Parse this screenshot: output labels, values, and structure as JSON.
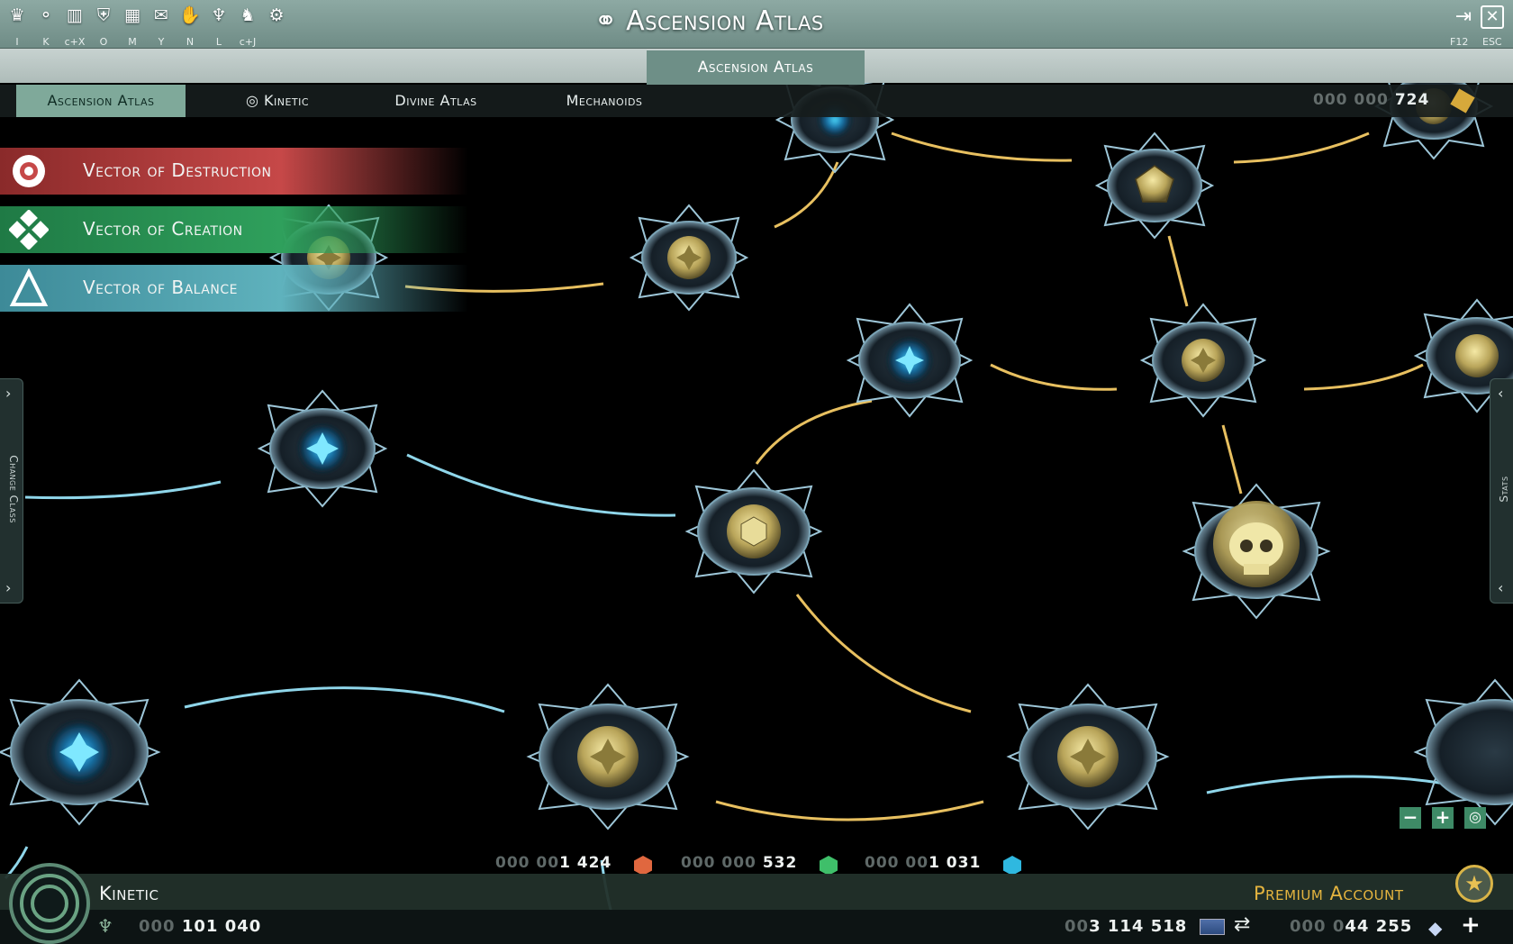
{
  "window": {
    "title": "Ascension Atlas",
    "top_icons": [
      "alert-icon",
      "network-icon",
      "stats-icon",
      "armor-icon",
      "map-icon",
      "chat-icon",
      "handshake-icon",
      "clan-icon",
      "mount-icon",
      "settings-icon"
    ],
    "hotkeys": [
      "I",
      "K",
      "c+X",
      "O",
      "M",
      "Y",
      "N",
      "L",
      "c+J"
    ],
    "right_hotkeys": [
      "F12",
      "ESC"
    ]
  },
  "subheader": {
    "active_tab": "Ascension Atlas"
  },
  "tabs": [
    {
      "label": "Ascension Atlas",
      "active": true
    },
    {
      "label": "Kinetic",
      "active": false
    },
    {
      "label": "Divine Atlas",
      "active": false
    },
    {
      "label": "Mechanoids",
      "active": false
    }
  ],
  "top_resource": {
    "dim": "000 000",
    "value": "724",
    "icon": "gold-cube-icon"
  },
  "vectors": [
    {
      "label": "Vector of Destruction",
      "icon": "destruction-spiral-icon",
      "color": "#c64848"
    },
    {
      "label": "Vector of Creation",
      "icon": "creation-diamond-icon",
      "color": "#2fa05c"
    },
    {
      "label": "Vector of Balance",
      "icon": "balance-triangle-icon",
      "color": "#5fb2bd"
    }
  ],
  "side_tabs": {
    "left": "Change Class",
    "right": "Stats"
  },
  "bottom_resources": [
    {
      "dim": "000 00",
      "value": "1 424",
      "color": "#e0673f"
    },
    {
      "dim": "000 000",
      "value": "532",
      "color": "#3fbf6a"
    },
    {
      "dim": "000 00",
      "value": "1 031",
      "color": "#2fb8e0"
    }
  ],
  "class_bar": {
    "class_name": "Kinetic",
    "premium_label": "Premium Account"
  },
  "lower_bar": {
    "ascension_dim": "000",
    "ascension_value": "101 040",
    "credits_dim": "00",
    "credits_value": "3 114 518",
    "diamonds_dim": "000 0",
    "diamonds_value": "44 255"
  },
  "colors": {
    "gold_link": "#e8c060",
    "blue_link": "#8fd6ea",
    "node_blue": "#19a6e0",
    "node_gold": "#d9c778",
    "accent_green": "#6e8f87"
  }
}
